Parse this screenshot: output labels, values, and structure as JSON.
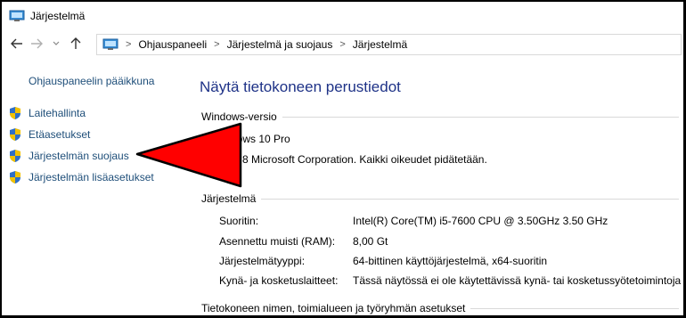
{
  "window": {
    "title": "Järjestelmä"
  },
  "navigation": {
    "breadcrumb": [
      "Ohjauspaneeli",
      "Järjestelmä ja suojaus",
      "Järjestelmä"
    ],
    "separator": ">"
  },
  "sidebar": {
    "home_link": "Ohjauspaneelin pääikkuna",
    "items": [
      {
        "label": "Laitehallinta"
      },
      {
        "label": "Etäasetukset"
      },
      {
        "label": "Järjestelmän suojaus"
      },
      {
        "label": "Järjestelmän lisäasetukset"
      }
    ]
  },
  "main": {
    "title": "Näytä tietokoneen perustiedot",
    "windows_section": {
      "heading": "Windows-versio",
      "edition": "dows 10 Pro",
      "copyright": "8 Microsoft Corporation. Kaikki oikeudet pidätetään."
    },
    "system_section": {
      "heading": "Järjestelmä",
      "rows": [
        {
          "label": "Suoritin:",
          "value": "Intel(R) Core(TM) i5-7600 CPU @ 3.50GHz   3.50 GHz"
        },
        {
          "label": "Asennettu muisti (RAM):",
          "value": "8,00 Gt"
        },
        {
          "label": "Järjestelmätyyppi:",
          "value": "64-bittinen käyttöjärjestelmä, x64-suoritin"
        },
        {
          "label": "Kynä- ja kosketuslaitteet:",
          "value": "Tässä näytössä ei ole käytettävissä kynä- tai kosketussyötetoimintoja"
        }
      ]
    },
    "computer_name_section": {
      "heading": "Tietokoneen nimen, toimialueen ja työryhmän asetukset"
    }
  },
  "colors": {
    "link": "#1e4e79",
    "title": "#1e3287",
    "annotation_arrow": "#ff0000"
  }
}
